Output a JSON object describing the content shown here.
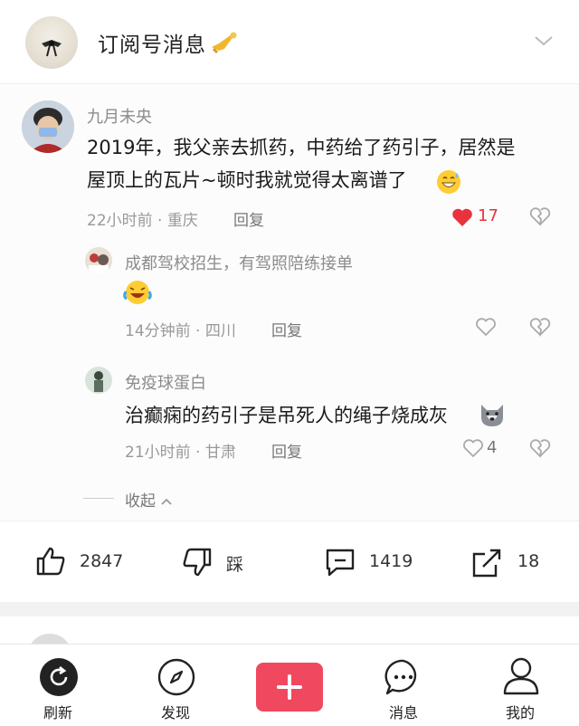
{
  "header": {
    "title": "订阅号消息",
    "avatar": "account-avatar",
    "badge_icon": "trumpet-icon",
    "expand_icon": "chevron-down-icon"
  },
  "comments": [
    {
      "user": "九月未央",
      "text_lines": [
        "2019年，我父亲去抓药，中药给了药引子，居然是",
        "屋顶上的瓦片~顿时我就觉得太离谱了"
      ],
      "emoji": "grinning-sweat-emoji",
      "meta": "22小时前 · 重庆",
      "reply_label": "回复",
      "likes": "17",
      "liked": true
    }
  ],
  "replies": [
    {
      "user": "成都驾校招生，有驾照陪练接单",
      "emoji": "crying-laughing-emoji",
      "meta": "14分钟前 · 四川",
      "reply_label": "回复",
      "likes": ""
    },
    {
      "user": "免疫球蛋白",
      "text": "治癫痫的药引子是吊死人的绳子烧成灰",
      "emoji": "wolf-emoji",
      "meta": "21小时前 · 甘肃",
      "reply_label": "回复",
      "likes": "4"
    }
  ],
  "collapse_label": "收起",
  "actions": {
    "like_count": "2847",
    "dislike_label": "踩",
    "comment_count": "1419",
    "share_count": "18"
  },
  "tabs": [
    {
      "label": "刷新",
      "icon": "refresh-icon"
    },
    {
      "label": "发现",
      "icon": "compass-icon"
    },
    {
      "label": "",
      "icon": "plus-icon"
    },
    {
      "label": "消息",
      "icon": "message-icon"
    },
    {
      "label": "我的",
      "icon": "user-icon"
    }
  ],
  "colors": {
    "accent_red": "#f0495f",
    "liked_heart": "#e8323c",
    "meta_gray": "#999999"
  }
}
